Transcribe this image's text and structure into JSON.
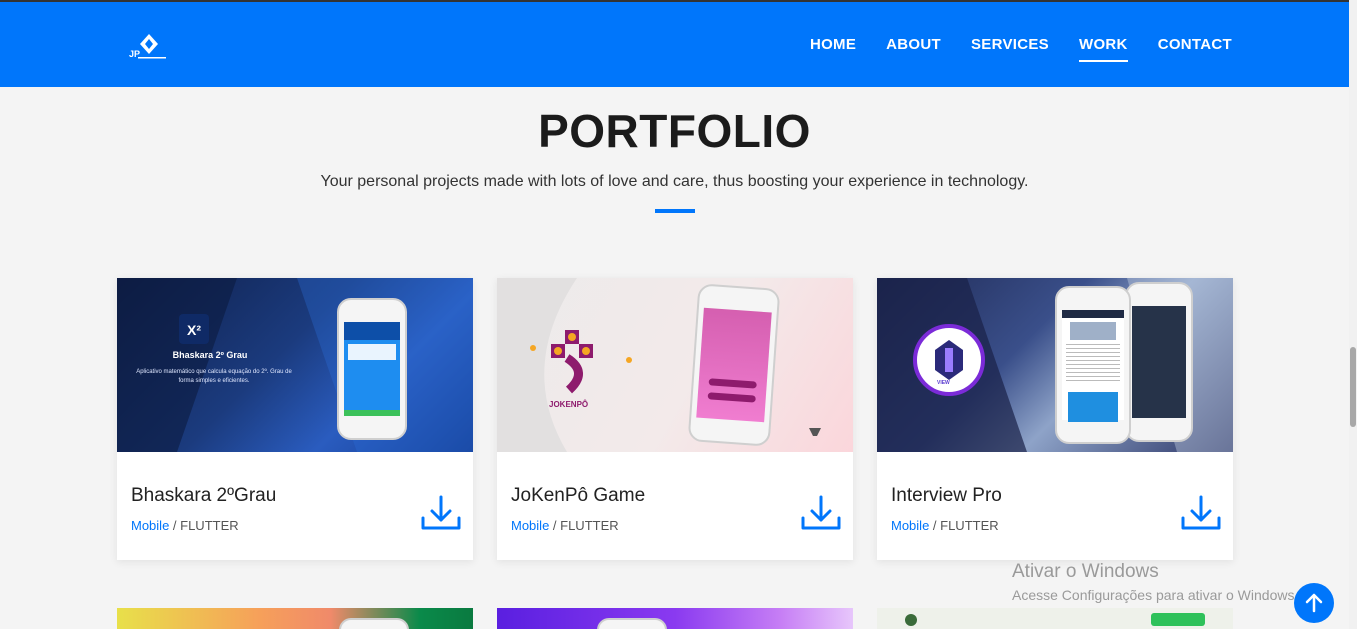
{
  "nav": {
    "items": [
      {
        "label": "HOME",
        "active": false
      },
      {
        "label": "ABOUT",
        "active": false
      },
      {
        "label": "SERVICES",
        "active": false
      },
      {
        "label": "WORK",
        "active": true
      },
      {
        "label": "CONTACT",
        "active": false
      }
    ],
    "logo_icon": "jp-diamond-logo"
  },
  "header": {
    "title": "PORTFOLIO",
    "subtitle": "Your personal projects made with lots of love and care, thus boosting your experience in technology."
  },
  "cards": [
    {
      "title": "Bhaskara 2ºGrau",
      "category": "Mobile",
      "separator": " / ",
      "tech": "FLUTTER",
      "img_title": "Bhaskara 2º Grau",
      "img_desc": "Aplicativo matemático que calcula equação do 2º. Grau de forma simples e eficientes."
    },
    {
      "title": "JoKenPô Game",
      "category": "Mobile",
      "separator": " / ",
      "tech": "FLUTTER",
      "img_title": "JOKENPÔ"
    },
    {
      "title": "Interview Pro",
      "category": "Mobile",
      "separator": " / ",
      "tech": "FLUTTER",
      "img_title": "VIEW"
    }
  ],
  "watermark": {
    "line1": "Ativar o Windows",
    "line2": "Acesse Configurações para ativar o Windows."
  },
  "colors": {
    "brand": "#0076fb",
    "background": "#f4f4f4"
  }
}
